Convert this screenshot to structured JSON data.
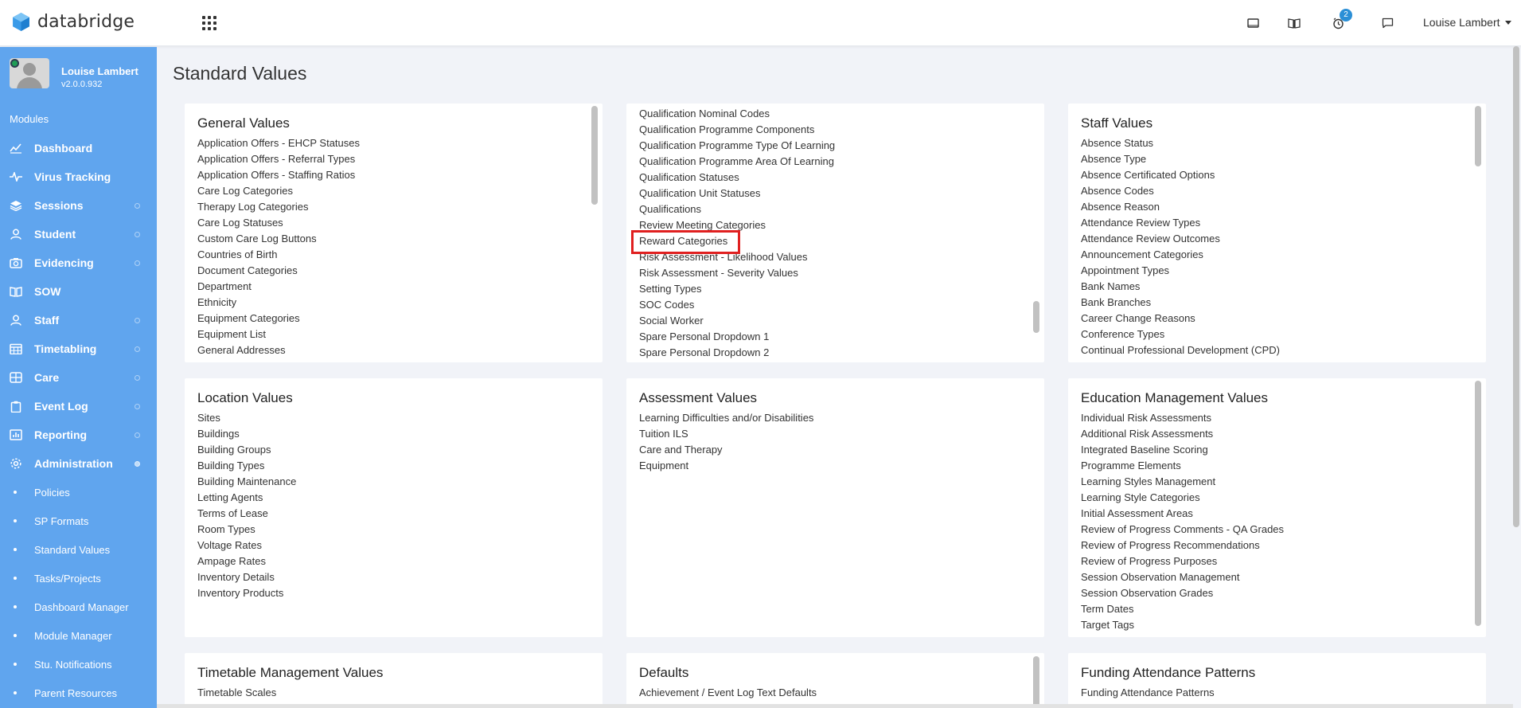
{
  "header": {
    "brand": "databridge",
    "notification_count": "2",
    "user_name": "Louise Lambert"
  },
  "sidebar": {
    "profile_name": "Louise Lambert",
    "version": "v2.0.0.932",
    "modules_label": "Modules",
    "items": [
      {
        "label": "Dashboard",
        "icon": "chart-line-icon",
        "dot": "none"
      },
      {
        "label": "Virus Tracking",
        "icon": "pulse-icon",
        "dot": "none"
      },
      {
        "label": "Sessions",
        "icon": "layers-icon",
        "dot": "empty"
      },
      {
        "label": "Student",
        "icon": "users-icon",
        "dot": "empty"
      },
      {
        "label": "Evidencing",
        "icon": "camera-icon",
        "dot": "empty"
      },
      {
        "label": "SOW",
        "icon": "book-icon",
        "dot": "none"
      },
      {
        "label": "Staff",
        "icon": "users-icon",
        "dot": "empty"
      },
      {
        "label": "Timetabling",
        "icon": "calendar-icon",
        "dot": "empty"
      },
      {
        "label": "Care",
        "icon": "grid-icon",
        "dot": "empty"
      },
      {
        "label": "Event Log",
        "icon": "clipboard-icon",
        "dot": "empty"
      },
      {
        "label": "Reporting",
        "icon": "chart-bar-icon",
        "dot": "empty"
      },
      {
        "label": "Administration",
        "icon": "gear-icon",
        "dot": "filled"
      }
    ],
    "sub_items": [
      "Policies",
      "SP Formats",
      "Standard Values",
      "Tasks/Projects",
      "Dashboard Manager",
      "Module Manager",
      "Stu. Notifications",
      "Parent Resources"
    ]
  },
  "main": {
    "page_title": "Standard Values",
    "cards": [
      {
        "title": "General Values",
        "items": [
          "Application Offers - EHCP Statuses",
          "Application Offers - Referral Types",
          "Application Offers - Staffing Ratios",
          "Care Log Categories",
          "Therapy Log Categories",
          "Care Log Statuses",
          "Custom Care Log Buttons",
          "Countries of Birth",
          "Document Categories",
          "Department",
          "Ethnicity",
          "Equipment Categories",
          "Equipment List",
          "General Addresses"
        ]
      },
      {
        "title": "",
        "items": [
          "Qualification Nominal Codes",
          "Qualification Programme Components",
          "Qualification Programme Type Of Learning",
          "Qualification Programme Area Of Learning",
          "Qualification Statuses",
          "Qualification Unit Statuses",
          "Qualifications",
          "Review Meeting Categories",
          "Reward Categories",
          "Risk Assessment - Likelihood Values",
          "Risk Assessment - Severity Values",
          "Setting Types",
          "SOC Codes",
          "Social Worker",
          "Spare Personal Dropdown 1",
          "Spare Personal Dropdown 2"
        ],
        "highlighted": "Reward Categories"
      },
      {
        "title": "Staff Values",
        "items": [
          "Absence Status",
          "Absence Type",
          "Absence Certificated Options",
          "Absence Codes",
          "Absence Reason",
          "Attendance Review Types",
          "Attendance Review Outcomes",
          "Announcement Categories",
          "Appointment Types",
          "Bank Names",
          "Bank Branches",
          "Career Change Reasons",
          "Conference Types",
          "Continual Professional Development (CPD)"
        ]
      },
      {
        "title": "Location Values",
        "items": [
          "Sites",
          "Buildings",
          "Building Groups",
          "Building Types",
          "Building Maintenance",
          "Letting Agents",
          "Terms of Lease",
          "Room Types",
          "Voltage Rates",
          "Ampage Rates",
          "Inventory Details",
          "Inventory Products"
        ]
      },
      {
        "title": "Assessment Values",
        "items": [
          "Learning Difficulties and/or Disabilities",
          "Tuition ILS",
          "Care and Therapy",
          "Equipment"
        ]
      },
      {
        "title": "Education Management Values",
        "items": [
          "Individual Risk Assessments",
          "Additional Risk Assessments",
          "Integrated Baseline Scoring",
          "Programme Elements",
          "Learning Styles Management",
          "Learning Style Categories",
          "Initial Assessment Areas",
          "Review of Progress Comments - QA Grades",
          "Review of Progress Recommendations",
          "Review of Progress Purposes",
          "Session Observation Management",
          "Session Observation Grades",
          "Term Dates",
          "Target Tags"
        ]
      },
      {
        "title": "Timetable Management Values",
        "items": [
          "Timetable Scales"
        ]
      },
      {
        "title": "Defaults",
        "items": [
          "Achievement / Event Log Text Defaults"
        ]
      },
      {
        "title": "Funding Attendance Patterns",
        "items": [
          "Funding Attendance Patterns"
        ]
      }
    ]
  }
}
